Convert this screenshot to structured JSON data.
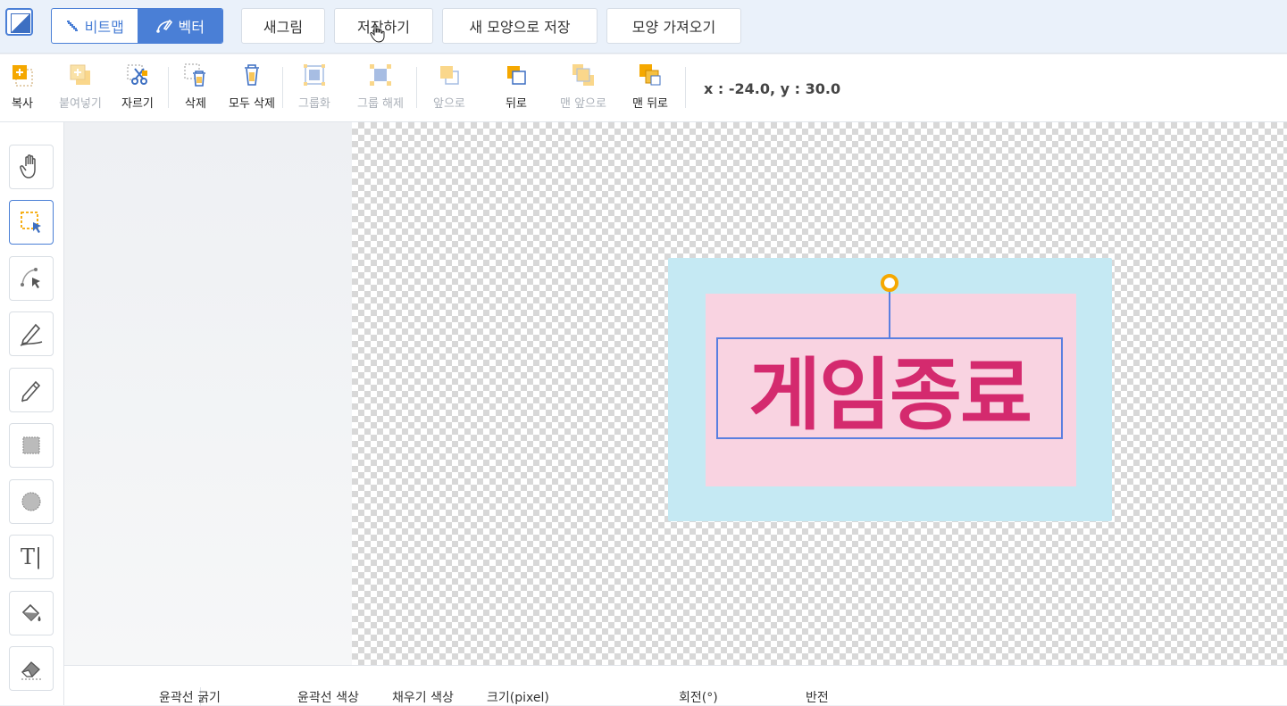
{
  "topbar": {
    "mode_bitmap": "비트맵",
    "mode_vector": "벡터",
    "new_drawing": "새그림",
    "save": "저장하기",
    "save_new_shape": "새 모양으로 저장",
    "import_shape": "모양 가져오기"
  },
  "toolbar": {
    "copy": "복사",
    "paste": "붙여넣기",
    "cut": "자르기",
    "delete": "삭제",
    "delete_all": "모두 삭제",
    "group": "그룹화",
    "ungroup": "그룹 해제",
    "forward": "앞으로",
    "backward": "뒤로",
    "to_front": "맨 앞으로",
    "to_back": "맨 뒤로",
    "coords": "x : -24.0, y : 30.0"
  },
  "left_tools": [
    "hand",
    "select",
    "node-edit",
    "pen",
    "pencil",
    "rectangle",
    "ellipse",
    "text",
    "fill",
    "eraser"
  ],
  "left_text_tool_glyph": "T|",
  "canvas": {
    "sign_text": "게임종료",
    "colors": {
      "outer": "#c5e9f3",
      "inner": "#f9d3e1",
      "text": "#d42a6e",
      "selection": "#5a7fe0",
      "handle": "#f5a800"
    }
  },
  "bottom": {
    "stroke_width": "윤곽선 굵기",
    "stroke_color": "윤곽선 색상",
    "fill_color": "채우기 색상",
    "size": "크기(pixel)",
    "rotation": "회전(°)",
    "flip": "반전"
  },
  "accent": "#4a7fd6"
}
